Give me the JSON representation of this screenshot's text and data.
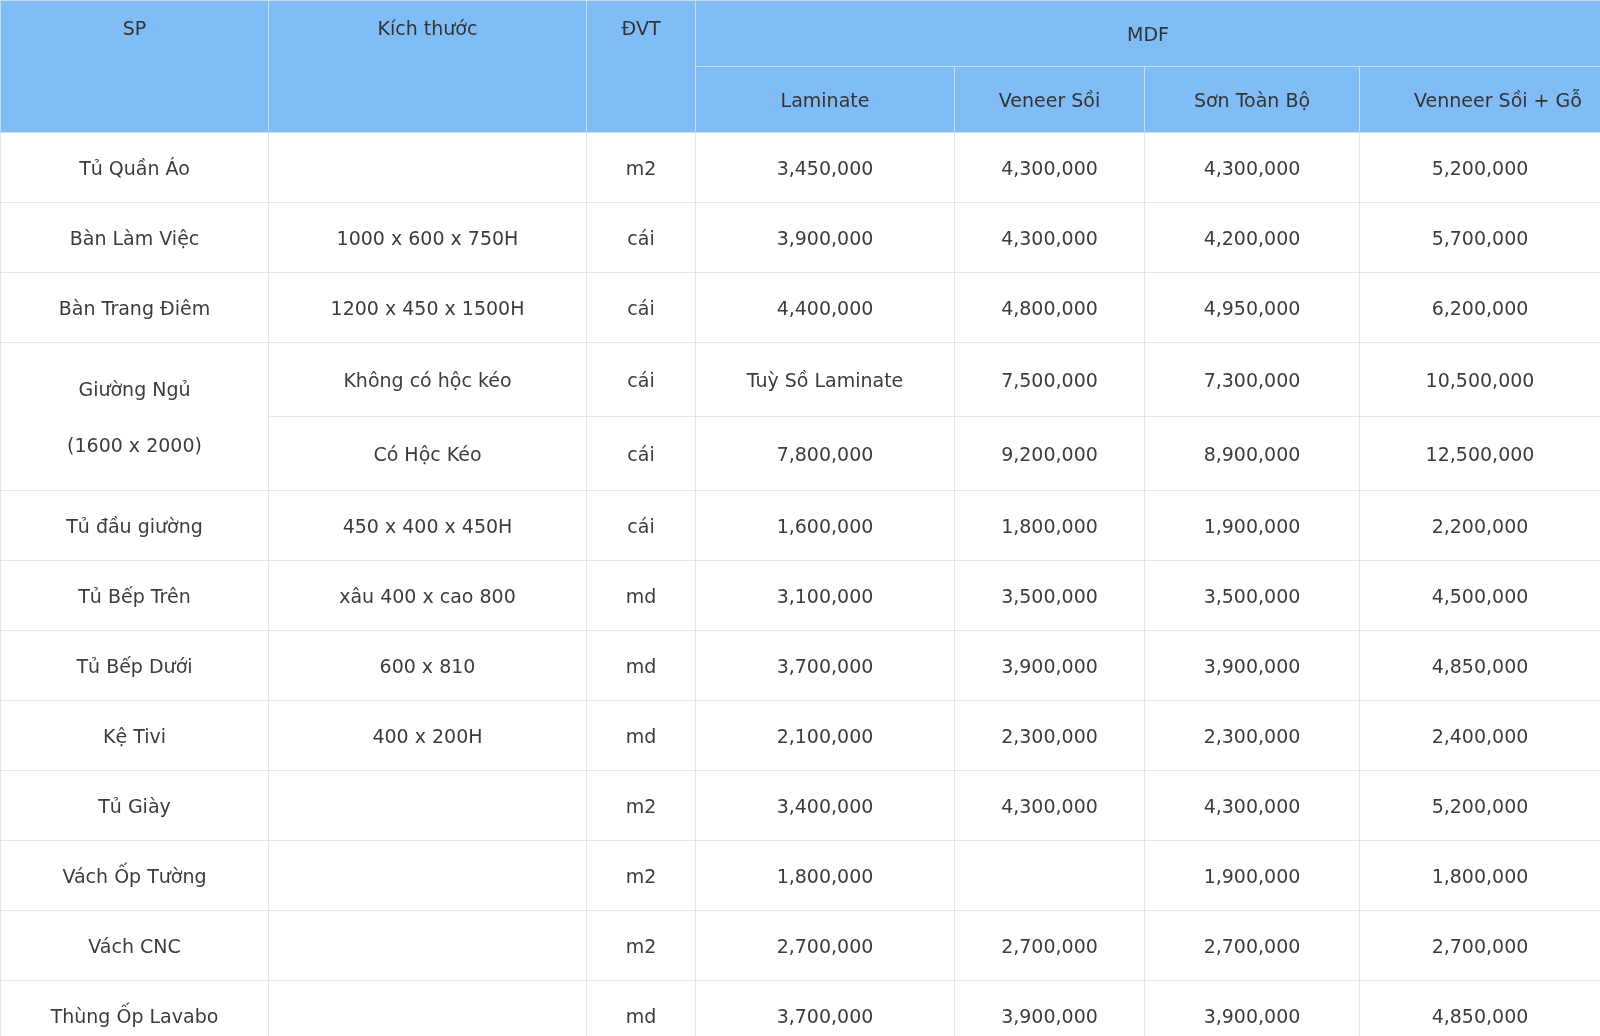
{
  "table": {
    "columns": [
      "SP",
      "Kích thước",
      "ĐVT"
    ],
    "group_header": "MDF",
    "price_columns": [
      "Laminate",
      "Veneer Sồi",
      "Sơn Toàn Bộ",
      "Venneer Sồi + Gỗ"
    ],
    "rows": [
      {
        "product": "Tủ Quần Áo",
        "variants": [
          {
            "unit": "m2",
            "prices": {
              "laminate": "3,450,000",
              "veneer": "4,300,000",
              "paint": "4,300,000",
              "veneer_wood": "5,200,000"
            }
          }
        ]
      },
      {
        "product": "Bàn Làm Việc",
        "variants": [
          {
            "size": "1000 x 600 x 750H",
            "unit": "cái",
            "prices": {
              "laminate": "3,900,000",
              "veneer": "4,300,000",
              "paint": "4,200,000",
              "veneer_wood": "5,700,000"
            }
          }
        ]
      },
      {
        "product": "Bàn Trang Điêm",
        "variants": [
          {
            "size": "1200 x 450 x 1500H",
            "unit": "cái",
            "prices": {
              "laminate": "4,400,000",
              "veneer": "4,800,000",
              "paint": "4,950,000",
              "veneer_wood": "6,200,000"
            }
          }
        ]
      },
      {
        "product": "Giường Ngủ",
        "product_note": "(1600 x 2000)",
        "variants": [
          {
            "size": "Không có hộc kéo",
            "unit": "cái",
            "prices": {
              "laminate": "Tuỳ Sồ Laminate",
              "veneer": "7,500,000",
              "paint": "7,300,000",
              "veneer_wood": "10,500,000"
            }
          },
          {
            "size": "Có Hộc Kéo",
            "unit": "cái",
            "prices": {
              "laminate": "7,800,000",
              "veneer": "9,200,000",
              "paint": "8,900,000",
              "veneer_wood": "12,500,000"
            }
          }
        ]
      },
      {
        "product": "Tủ đầu giường",
        "variants": [
          {
            "size": "450 x 400 x 450H",
            "unit": "cái",
            "prices": {
              "laminate": "1,600,000",
              "veneer": "1,800,000",
              "paint": "1,900,000",
              "veneer_wood": "2,200,000"
            }
          }
        ]
      },
      {
        "product": "Tủ Bếp Trên",
        "variants": [
          {
            "size": "xâu 400 x cao 800",
            "unit": "md",
            "prices": {
              "laminate": "3,100,000",
              "veneer": "3,500,000",
              "paint": "3,500,000",
              "veneer_wood": "4,500,000"
            }
          }
        ]
      },
      {
        "product": "Tủ Bếp Dưới",
        "variants": [
          {
            "size": "600 x 810",
            "unit": "md",
            "prices": {
              "laminate": "3,700,000",
              "veneer": "3,900,000",
              "paint": "3,900,000",
              "veneer_wood": "4,850,000"
            }
          }
        ]
      },
      {
        "product": "Kệ Tivi",
        "variants": [
          {
            "size": "400 x 200H",
            "unit": "md",
            "prices": {
              "laminate": "2,100,000",
              "veneer": "2,300,000",
              "paint": "2,300,000",
              "veneer_wood": "2,400,000"
            }
          }
        ]
      },
      {
        "product": "Tủ Giày",
        "variants": [
          {
            "unit": "m2",
            "prices": {
              "laminate": "3,400,000",
              "veneer": "4,300,000",
              "paint": "4,300,000",
              "veneer_wood": "5,200,000"
            }
          }
        ]
      },
      {
        "product": "Vách Ốp Tường",
        "variants": [
          {
            "unit": "m2",
            "prices": {
              "laminate": "1,800,000",
              "paint": "1,900,000",
              "veneer_wood": "1,800,000"
            }
          }
        ]
      },
      {
        "product": "Vách CNC",
        "variants": [
          {
            "unit": "m2",
            "prices": {
              "laminate": "2,700,000",
              "veneer": "2,700,000",
              "paint": "2,700,000",
              "veneer_wood": "2,700,000"
            }
          }
        ]
      },
      {
        "product": "Thùng Ốp Lavabo",
        "variants": [
          {
            "unit": "md",
            "prices": {
              "laminate": "3,700,000",
              "veneer": "3,900,000",
              "paint": "3,900,000",
              "veneer_wood": "4,850,000"
            }
          }
        ]
      }
    ]
  }
}
